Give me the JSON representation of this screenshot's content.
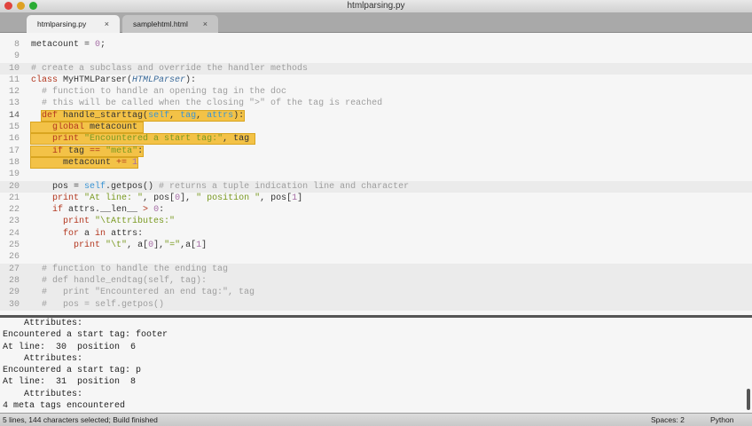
{
  "window": {
    "title": "htmlparsing.py"
  },
  "tabs": [
    {
      "label": "htmlparsing.py",
      "active": true
    },
    {
      "label": "samplehtml.html",
      "active": false
    }
  ],
  "tab_close": "×",
  "code_lines": [
    {
      "n": "8",
      "band": false,
      "t": [
        [
          "",
          "metacount = "
        ],
        [
          "num",
          "0"
        ],
        [
          "",
          ";"
        ]
      ]
    },
    {
      "n": "9",
      "band": false,
      "t": []
    },
    {
      "n": "10",
      "band": true,
      "t": [
        [
          "com",
          "# create a subclass and override the handler methods"
        ]
      ]
    },
    {
      "n": "11",
      "band": false,
      "t": [
        [
          "kw",
          "class"
        ],
        [
          "",
          " MyHTMLParser("
        ],
        [
          "cls",
          "HTMLParser"
        ],
        [
          "",
          "):"
        ]
      ]
    },
    {
      "n": "12",
      "band": false,
      "t": [
        [
          "",
          "  "
        ],
        [
          "com",
          "# function to handle an opening tag in the doc"
        ]
      ]
    },
    {
      "n": "13",
      "band": false,
      "t": [
        [
          "",
          "  "
        ],
        [
          "com",
          "# this will be called when the closing \">\" of the tag is reached"
        ]
      ]
    },
    {
      "n": "14",
      "band": false,
      "cur": true,
      "sel": true,
      "selStart": 2,
      "t": [
        [
          "",
          "  "
        ],
        [
          "kw",
          "def"
        ],
        [
          "",
          " handle_starttag("
        ],
        [
          "self",
          "self"
        ],
        [
          "",
          ", "
        ],
        [
          "self",
          "tag"
        ],
        [
          "",
          ", "
        ],
        [
          "self",
          "attrs"
        ],
        [
          "",
          "):"
        ]
      ]
    },
    {
      "n": "15",
      "band": false,
      "sel": true,
      "t": [
        [
          "",
          "    "
        ],
        [
          "kw",
          "global"
        ],
        [
          "",
          " metacount "
        ]
      ]
    },
    {
      "n": "16",
      "band": false,
      "sel": true,
      "t": [
        [
          "",
          "    "
        ],
        [
          "kw",
          "print"
        ],
        [
          "",
          " "
        ],
        [
          "str",
          "\"Encountered a start tag:\""
        ],
        [
          "",
          ", tag "
        ]
      ]
    },
    {
      "n": "17",
      "band": false,
      "sel": true,
      "t": [
        [
          "",
          "    "
        ],
        [
          "kw",
          "if"
        ],
        [
          "",
          " tag "
        ],
        [
          "kw",
          "=="
        ],
        [
          "",
          " "
        ],
        [
          "str",
          "\"meta\""
        ],
        [
          "",
          ":"
        ]
      ]
    },
    {
      "n": "18",
      "band": false,
      "sel": true,
      "t": [
        [
          "",
          "      metacount "
        ],
        [
          "kw",
          "+="
        ],
        [
          "",
          " "
        ],
        [
          "num",
          "1"
        ]
      ]
    },
    {
      "n": "19",
      "band": false,
      "t": []
    },
    {
      "n": "20",
      "band": true,
      "t": [
        [
          "",
          "    pos = "
        ],
        [
          "self",
          "self"
        ],
        [
          "",
          ".getpos() "
        ],
        [
          "com",
          "# returns a tuple indication line and character"
        ]
      ]
    },
    {
      "n": "21",
      "band": false,
      "t": [
        [
          "",
          "    "
        ],
        [
          "kw",
          "print"
        ],
        [
          "",
          " "
        ],
        [
          "str",
          "\"At line: \""
        ],
        [
          "",
          ", pos["
        ],
        [
          "num",
          "0"
        ],
        [
          "",
          "], "
        ],
        [
          "str",
          "\" position \""
        ],
        [
          "",
          ", pos["
        ],
        [
          "num",
          "1"
        ],
        [
          "",
          "]"
        ]
      ]
    },
    {
      "n": "22",
      "band": false,
      "t": [
        [
          "",
          "    "
        ],
        [
          "kw",
          "if"
        ],
        [
          "",
          " attrs.__len__ "
        ],
        [
          "kw",
          ">"
        ],
        [
          "",
          " "
        ],
        [
          "num",
          "0"
        ],
        [
          "",
          ":"
        ]
      ]
    },
    {
      "n": "23",
      "band": false,
      "t": [
        [
          "",
          "      "
        ],
        [
          "kw",
          "print"
        ],
        [
          "",
          " "
        ],
        [
          "str",
          "\"\\tAttributes:\""
        ]
      ]
    },
    {
      "n": "24",
      "band": false,
      "t": [
        [
          "",
          "      "
        ],
        [
          "kw",
          "for"
        ],
        [
          "",
          " a "
        ],
        [
          "kw",
          "in"
        ],
        [
          "",
          " attrs:"
        ]
      ]
    },
    {
      "n": "25",
      "band": false,
      "t": [
        [
          "",
          "        "
        ],
        [
          "kw",
          "print"
        ],
        [
          "",
          " "
        ],
        [
          "str",
          "\"\\t\""
        ],
        [
          "",
          ", a["
        ],
        [
          "num",
          "0"
        ],
        [
          "",
          "],"
        ],
        [
          "str",
          "\"=\""
        ],
        [
          "",
          ",a["
        ],
        [
          "num",
          "1"
        ],
        [
          "",
          "]"
        ]
      ]
    },
    {
      "n": "26",
      "band": false,
      "t": []
    },
    {
      "n": "27",
      "band": true,
      "t": [
        [
          "",
          "  "
        ],
        [
          "com",
          "# function to handle the ending tag"
        ]
      ]
    },
    {
      "n": "28",
      "band": true,
      "t": [
        [
          "",
          "  "
        ],
        [
          "com",
          "# def handle_endtag(self, tag):"
        ]
      ]
    },
    {
      "n": "29",
      "band": true,
      "t": [
        [
          "",
          "  "
        ],
        [
          "com",
          "#   print \"Encountered an end tag:\", tag"
        ]
      ]
    },
    {
      "n": "30",
      "band": true,
      "t": [
        [
          "",
          "  "
        ],
        [
          "com",
          "#   pos = self.getpos()"
        ]
      ]
    }
  ],
  "output": [
    "    Attributes:",
    "Encountered a start tag: footer",
    "At line:  30  position  6",
    "    Attributes:",
    "Encountered a start tag: p",
    "At line:  31  position  8",
    "    Attributes:",
    "4 meta tags encountered"
  ],
  "status": {
    "left": "5 lines, 144 characters selected; Build finished",
    "spaces": "Spaces: 2",
    "syntax": "Python"
  },
  "colors": {
    "selection": "#f3c247",
    "keyword": "#b3371f",
    "string": "#7a9a22",
    "self": "#3a94d4"
  }
}
